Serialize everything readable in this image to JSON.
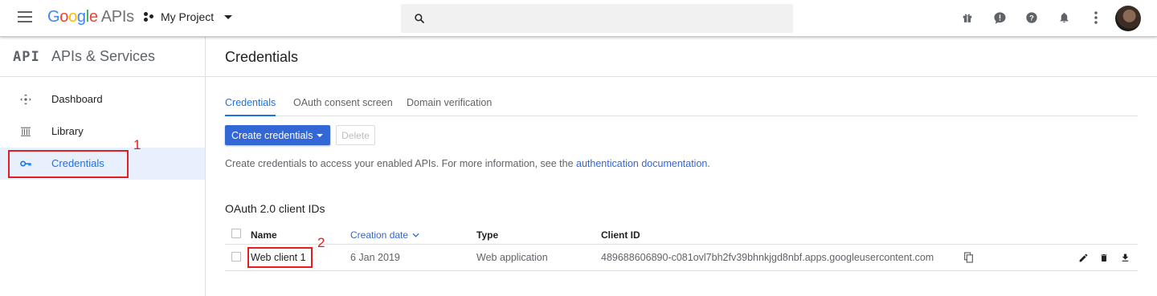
{
  "header": {
    "logo_google": "Google",
    "logo_apis": "APIs",
    "project": "My Project",
    "search_placeholder": ""
  },
  "sidebar": {
    "logo_text": "API",
    "title": "APIs & Services",
    "items": [
      {
        "label": "Dashboard",
        "icon": "dashboard-icon"
      },
      {
        "label": "Library",
        "icon": "library-icon"
      },
      {
        "label": "Credentials",
        "icon": "key-icon",
        "active": true
      }
    ]
  },
  "main": {
    "title": "Credentials",
    "tabs": [
      {
        "label": "Credentials",
        "active": true
      },
      {
        "label": "OAuth consent screen"
      },
      {
        "label": "Domain verification"
      }
    ],
    "create_button": "Create credentials",
    "delete_button": "Delete",
    "info_text": "Create credentials to access your enabled APIs. For more information, see the ",
    "info_link": "authentication documentation",
    "info_end": ".",
    "section_title": "OAuth 2.0 client IDs",
    "table": {
      "columns": [
        "Name",
        "Creation date",
        "Type",
        "Client ID"
      ],
      "rows": [
        {
          "name": "Web client 1",
          "date": "6 Jan 2019",
          "type": "Web application",
          "client_id": "489688606890-c081ovl7bh2fv39bhnkjgd8nbf.apps.googleusercontent.com"
        }
      ]
    }
  },
  "annotations": {
    "one": "1",
    "two": "2"
  },
  "colors": {
    "accent": "#1a73e8",
    "button": "#3367d6",
    "annotation": "#e02020"
  }
}
